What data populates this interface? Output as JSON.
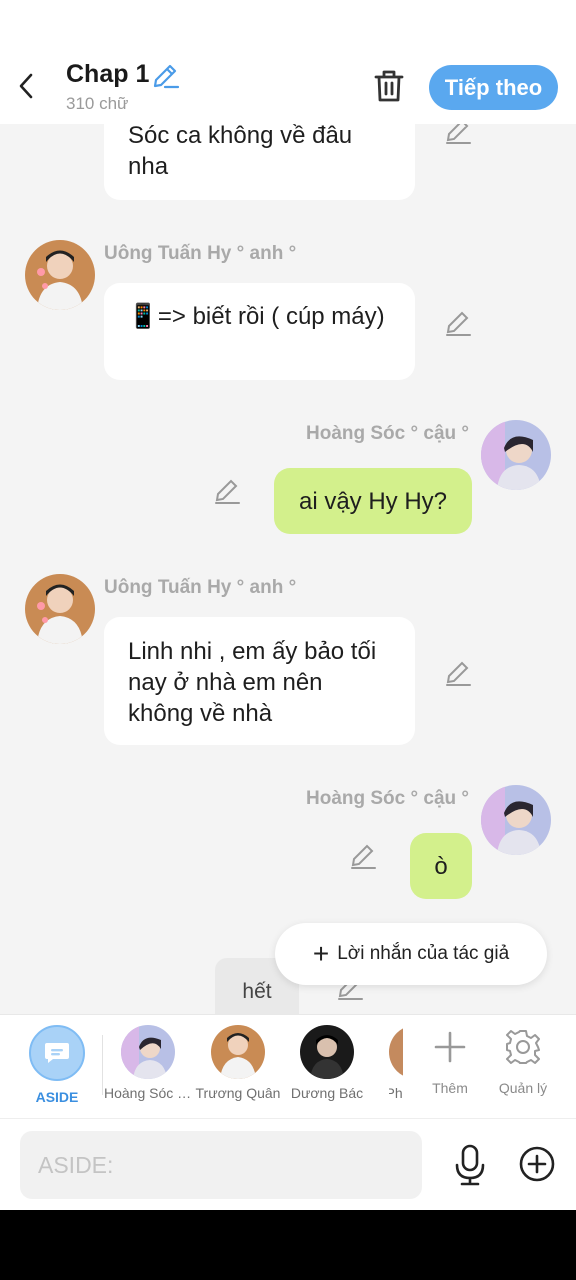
{
  "header": {
    "title": "Chap 1",
    "word_count": "310 chữ",
    "next_label": "Tiếp theo"
  },
  "messages": [
    {
      "side": "left",
      "text": "Sóc ca không về đâu nha"
    },
    {
      "side": "left",
      "sender": "Uông Tuấn Hy ° anh °",
      "text": "📱=> biết rồi ( cúp máy)"
    },
    {
      "side": "right",
      "sender": "Hoàng Sóc ° cậu °",
      "text": "ai vậy Hy Hy?"
    },
    {
      "side": "left",
      "sender": "Uông Tuấn Hy ° anh °",
      "text": "Linh nhi , em ấy bảo tối nay ở nhà em nên không về nhà"
    },
    {
      "side": "right",
      "sender": "Hoàng Sóc ° cậu °",
      "text": "ò"
    },
    {
      "side": "center",
      "text": "hết"
    }
  ],
  "author_note": {
    "plus": "+",
    "label": "Lời nhắn của tác giả"
  },
  "character_bar": {
    "aside_label": "ASIDE",
    "characters": [
      {
        "label": "Hoàng Sóc ° cậu °"
      },
      {
        "label": "Trương Quân"
      },
      {
        "label": "Dương Bác"
      },
      {
        "label": "Phó"
      }
    ],
    "add_label": "Thêm",
    "manage_label": "Quản lý"
  },
  "composer": {
    "placeholder": "ASIDE:"
  },
  "colors": {
    "accent": "#5aa8ef",
    "right_bubble": "#d3f08c",
    "left_bubble": "#ffffff",
    "background": "#f4f4f4"
  }
}
